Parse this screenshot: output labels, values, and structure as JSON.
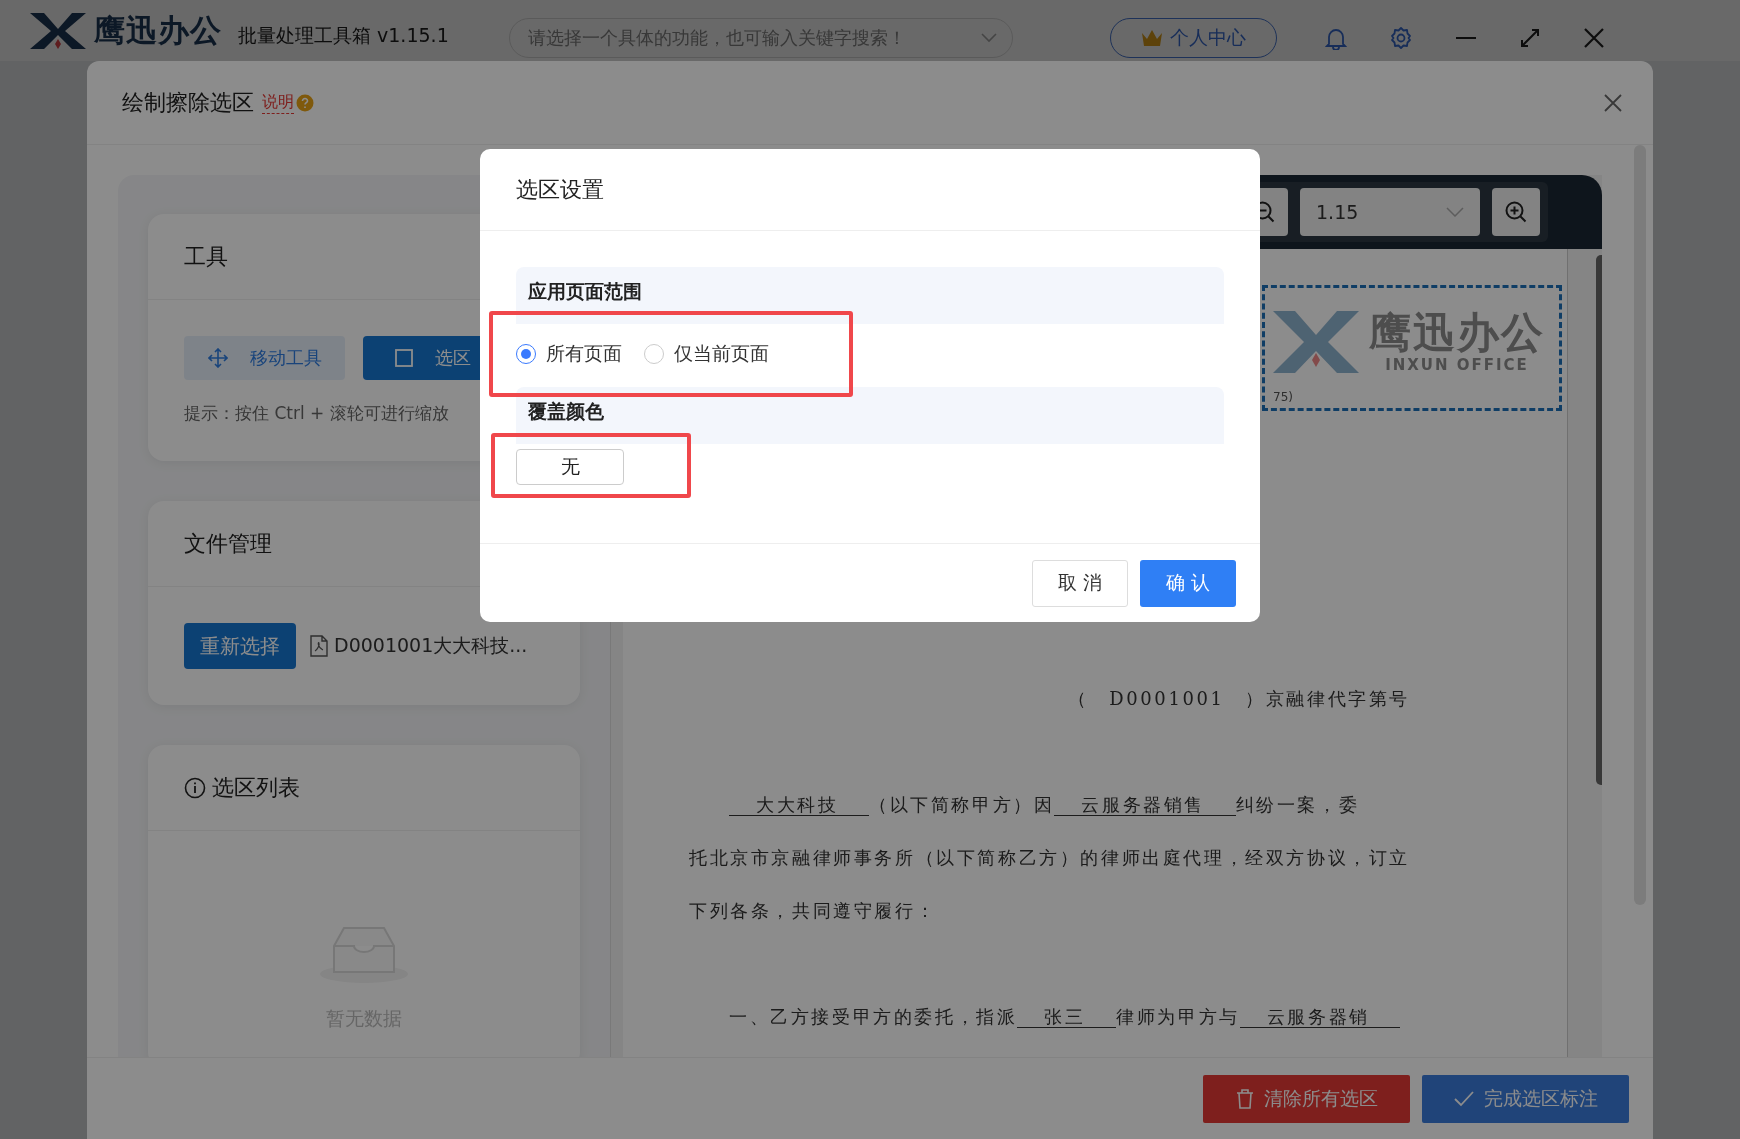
{
  "app": {
    "brand": "鹰迅办公",
    "title": "批量处理工具箱 v1.15.1",
    "search": {
      "placeholder": "请选择一个具体的功能，也可输入关键字搜索！"
    },
    "user_button": "个人中心"
  },
  "modal": {
    "title": "绘制擦除选区",
    "help_link": "说明",
    "tools": {
      "title": "工具",
      "buttons": [
        {
          "label": "移动工具",
          "kind": "move",
          "selected": false
        },
        {
          "label": "选区",
          "kind": "select",
          "selected": true
        }
      ],
      "hint": "提示：按住 Ctrl + 滚轮可进行缩放"
    },
    "files": {
      "title": "文件管理",
      "reselect": "重新选择",
      "file_name": "D0001001大大科技..."
    },
    "selections": {
      "title": "选区列表",
      "empty": "暂无数据"
    },
    "viewer": {
      "zoom": "1.15",
      "page": {
        "logo_name": "鹰迅办公",
        "logo_sub": "INXUN OFFICE",
        "selection_label": "75)",
        "paragraphs": [
          {
            "kind": "reference",
            "lines": [
              [
                {
                  "text": "（　D0001001　）京融律代字第号",
                  "underline": false
                }
              ]
            ]
          },
          {
            "kind": "body",
            "lines": [
              [
                {
                  "text": "大大科技",
                  "underline": true
                },
                {
                  "text": "（以下简称甲方）因",
                  "underline": false
                },
                {
                  "text": "云服务器销售",
                  "underline": true
                },
                {
                  "text": "纠纷一案，委",
                  "underline": false
                }
              ],
              [
                {
                  "text": "托北京市京融律师事务所（以下简称乙方）的律师出庭代理，经双方协议，订立",
                  "underline": false
                }
              ],
              [
                {
                  "text": "下列各条，共同遵守履行：",
                  "underline": false
                }
              ]
            ]
          },
          {
            "kind": "body",
            "lines": [
              [
                {
                  "text": "一、乙方接受甲方的委托，指派",
                  "underline": false
                },
                {
                  "text": "张三",
                  "underline": true
                },
                {
                  "text": "律师为甲方与",
                  "underline": false
                },
                {
                  "text": "云服务器销",
                  "underline": true
                }
              ]
            ]
          }
        ]
      }
    },
    "footer": {
      "clear": "清除所有选区",
      "done": "完成选区标注"
    }
  },
  "dialog": {
    "title": "选区设置",
    "sections": [
      {
        "kind": "radio",
        "label": "应用页面范围",
        "highlighted": true,
        "options": [
          {
            "label": "所有页面",
            "selected": true
          },
          {
            "label": "仅当前页面",
            "selected": false
          }
        ]
      },
      {
        "kind": "color",
        "label": "覆盖颜色",
        "highlighted": true,
        "value": "无"
      }
    ],
    "buttons": [
      {
        "label": "取 消",
        "kind": "default"
      },
      {
        "label": "确 认",
        "kind": "primary"
      }
    ]
  }
}
